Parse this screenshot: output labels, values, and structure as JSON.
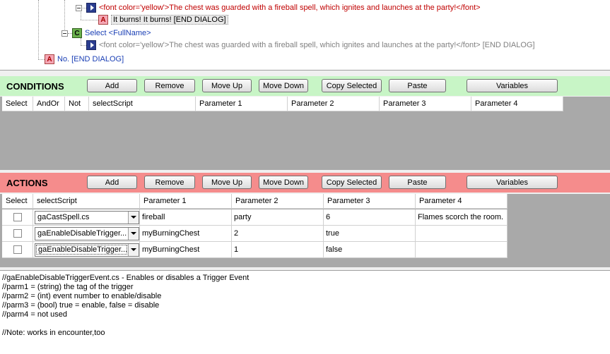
{
  "tree": {
    "nodes": [
      {
        "text": "<font color='yellow'>The chest was guarded with a fireball spell, which ignites and launches at the party!</font>"
      },
      {
        "icon_letter": "A",
        "text": "It burns! It burns! [END DIALOG]"
      },
      {
        "icon_letter": "C",
        "prefix": "Select",
        "text": "<FullName>"
      },
      {
        "text": "<font color='yellow'>The chest was guarded with a fireball spell, which ignites and launches at the party!</font> [END DIALOG]"
      },
      {
        "icon_letter": "A",
        "text": "No. [END DIALOG]"
      }
    ]
  },
  "conditions": {
    "title": "CONDITIONS",
    "buttons": [
      "Add",
      "Remove",
      "Move Up",
      "Move Down",
      "Copy Selected",
      "Paste",
      "Variables"
    ],
    "columns": [
      "Select",
      "AndOr",
      "Not",
      "selectScript",
      "Parameter 1",
      "Parameter 2",
      "Parameter 3",
      "Parameter 4"
    ]
  },
  "actions": {
    "title": "ACTIONS",
    "buttons": [
      "Add",
      "Remove",
      "Move Up",
      "Move Down",
      "Copy Selected",
      "Paste",
      "Variables"
    ],
    "columns": [
      "Select",
      "selectScript",
      "Parameter 1",
      "Parameter 2",
      "Parameter 3",
      "Parameter 4"
    ],
    "rows": [
      {
        "script": "gaCastSpell.cs",
        "p1": "fireball",
        "p2": "party",
        "p3": "6",
        "p4": "Flames scorch the room."
      },
      {
        "script": "gaEnableDisableTrigger...",
        "p1": "myBurningChest",
        "p2": "2",
        "p3": "true",
        "p4": ""
      },
      {
        "script": "gaEnableDisableTrigger...",
        "p1": "myBurningChest",
        "p2": "1",
        "p3": "false",
        "p4": ""
      }
    ]
  },
  "notes": {
    "lines": [
      "//gaEnableDisableTriggerEvent.cs - Enables or disables a Trigger Event",
      "//parm1 = (string) the tag of the trigger",
      "//parm2 = (int) event number to enable/disable",
      "//parm3 = (bool) true = enable, false = disable",
      "//parm4 = not used",
      "",
      "//Note: works in encounter,too"
    ]
  }
}
